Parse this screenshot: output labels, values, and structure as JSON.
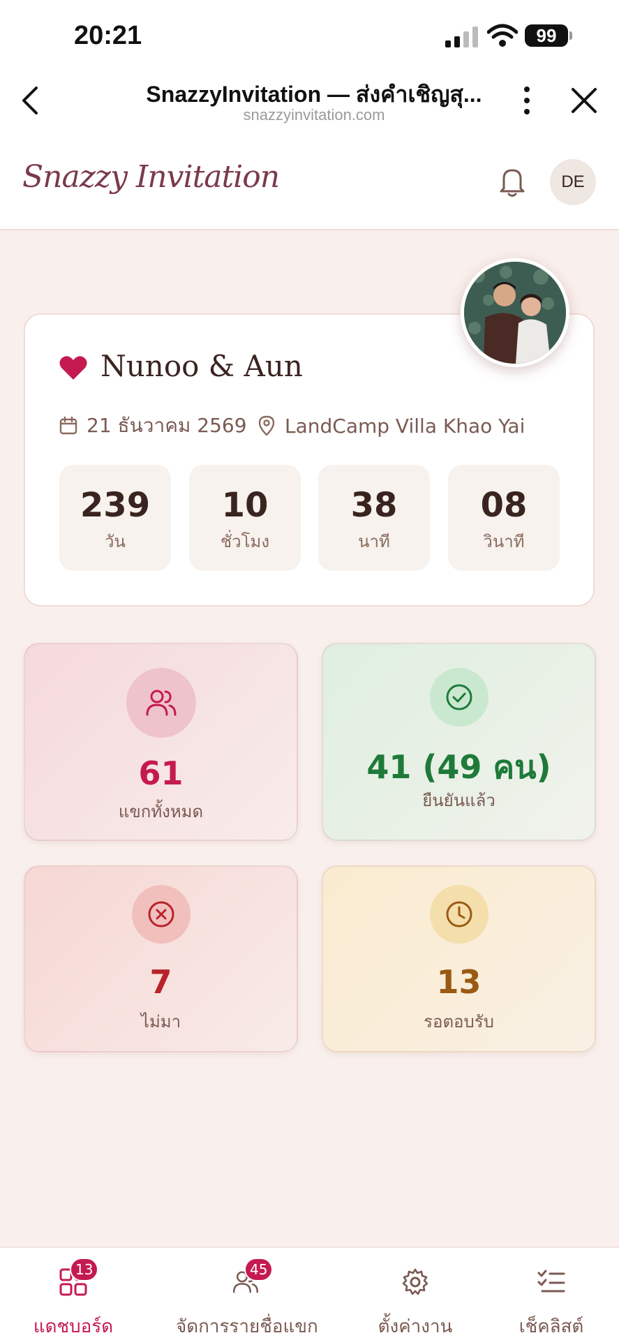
{
  "status_bar": {
    "time": "20:21",
    "battery": "99"
  },
  "browser": {
    "title": "SnazzyInvitation — ส่งคำเชิญสุ...",
    "url": "snazzyinvitation.com"
  },
  "header": {
    "logo_text": "Snazzy Invitation",
    "avatar_initials": "DE"
  },
  "event": {
    "name": "Nunoo & Aun",
    "date": "21 ธันวาคม 2569",
    "location": "LandCamp Villa Khao Yai",
    "countdown": [
      {
        "value": "239",
        "unit": "วัน"
      },
      {
        "value": "10",
        "unit": "ชั่วโมง"
      },
      {
        "value": "38",
        "unit": "นาที"
      },
      {
        "value": "08",
        "unit": "วินาที"
      }
    ]
  },
  "stats": {
    "total": {
      "value": "61",
      "label": "แขกทั้งหมด",
      "color": "#c41a50"
    },
    "confirmed": {
      "value": "41 (49 คน)",
      "label": "ยืนยันแล้ว",
      "color": "#1f7a3a"
    },
    "declined": {
      "value": "7",
      "label": "ไม่มา",
      "color": "#b8232a"
    },
    "pending": {
      "value": "13",
      "label": "รอตอบรับ",
      "color": "#9a5a12"
    }
  },
  "bottom_nav": [
    {
      "label": "แดชบอร์ด",
      "badge": "13",
      "icon": "dashboard-icon",
      "active": true
    },
    {
      "label": "จัดการรายชื่อแขก",
      "badge": "45",
      "icon": "users-icon",
      "active": false
    },
    {
      "label": "ตั้งค่างาน",
      "badge": "",
      "icon": "gear-icon",
      "active": false
    },
    {
      "label": "เช็คลิสต์",
      "badge": "",
      "icon": "checklist-icon",
      "active": false
    }
  ]
}
